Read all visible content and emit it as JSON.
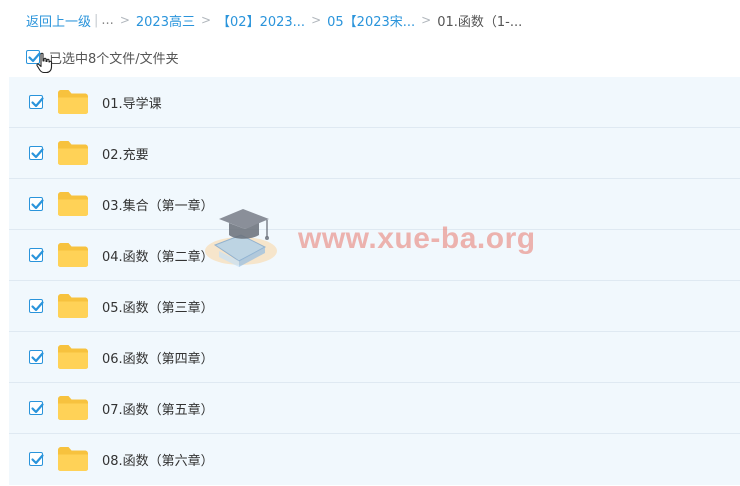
{
  "breadcrumb": {
    "back_label": "返回上一级",
    "ellipsis": "...",
    "items": [
      "2023高三",
      "【02】2023...",
      "05【2023宋..."
    ],
    "current": "01.函数（1-..."
  },
  "selection": {
    "label": "已选中8个文件/文件夹",
    "checked": true
  },
  "folders": [
    {
      "name": "01.导学课",
      "checked": true
    },
    {
      "name": "02.充要",
      "checked": true
    },
    {
      "name": "03.集合（第一章）",
      "checked": true
    },
    {
      "name": "04.函数（第二章）",
      "checked": true
    },
    {
      "name": "05.函数（第三章）",
      "checked": true
    },
    {
      "name": "06.函数（第四章）",
      "checked": true
    },
    {
      "name": "07.函数（第五章）",
      "checked": true
    },
    {
      "name": "08.函数（第六章）",
      "checked": true
    }
  ],
  "watermark": {
    "text": "www.xue-ba.org"
  },
  "colors": {
    "accent": "#2a94db",
    "folder": "#ffd257",
    "row_bg": "#f1f8fd",
    "watermark": "#e8786e"
  },
  "icons": {
    "folder": "folder-icon",
    "check": "checkmark-icon",
    "cursor": "hand-cursor-icon",
    "watermark_logo": "graduation-cap-icon"
  }
}
